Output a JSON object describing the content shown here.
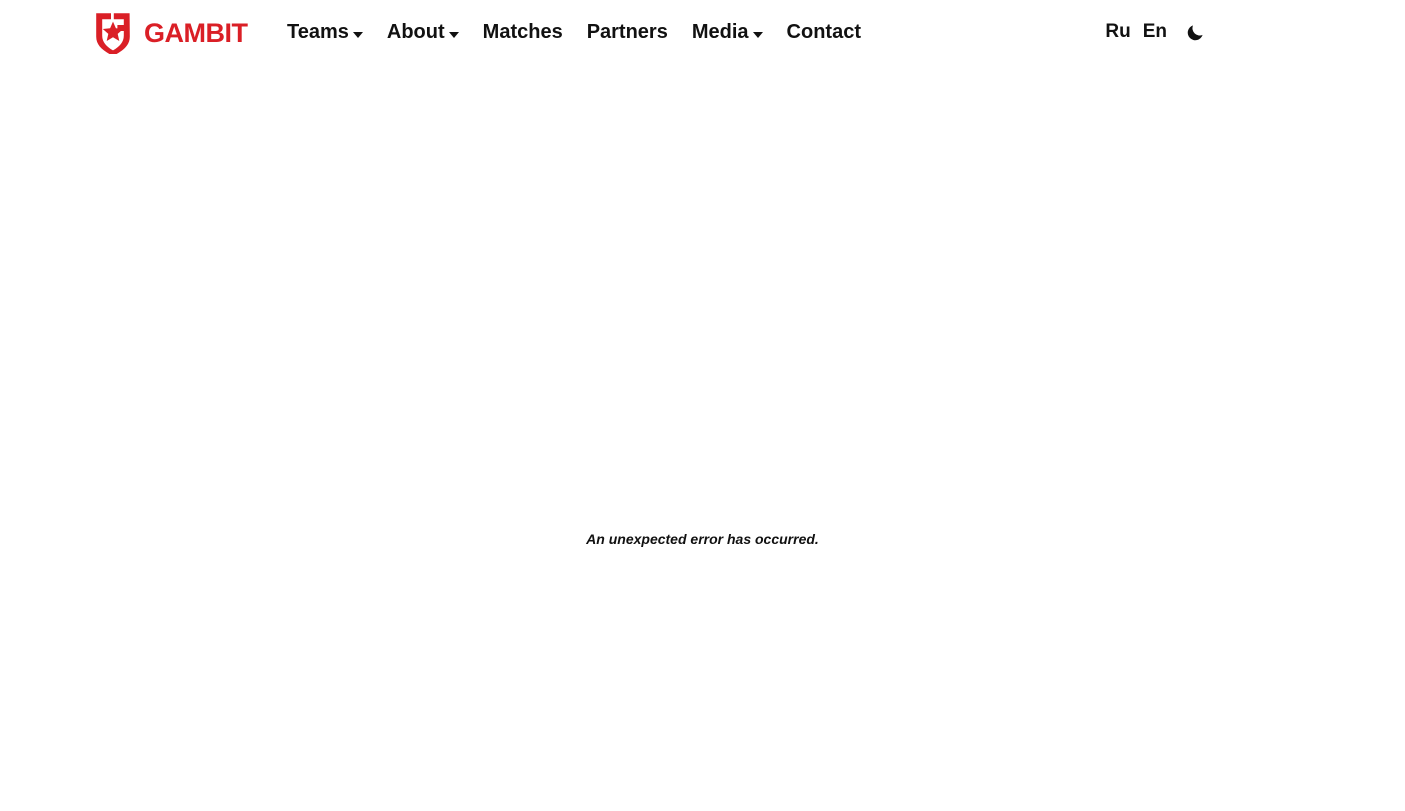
{
  "site": {
    "brand_name": "GAMBIT",
    "brand_icon": "gambit-shield-star-logo",
    "accent_color": "#da1f26",
    "text_color": "#111111",
    "background_color": "#ffffff"
  },
  "header": {
    "nav": [
      {
        "label": "Teams",
        "has_dropdown": true,
        "caret_icon": "chevron-down-icon"
      },
      {
        "label": "About",
        "has_dropdown": true,
        "caret_icon": "chevron-down-icon"
      },
      {
        "label": "Matches",
        "has_dropdown": false,
        "caret_icon": ""
      },
      {
        "label": "Partners",
        "has_dropdown": false,
        "caret_icon": ""
      },
      {
        "label": "Media",
        "has_dropdown": true,
        "caret_icon": "chevron-down-icon"
      },
      {
        "label": "Contact",
        "has_dropdown": false,
        "caret_icon": ""
      }
    ],
    "languages": [
      {
        "label": "Ru",
        "code": "ru"
      },
      {
        "label": "En",
        "code": "en"
      }
    ],
    "theme_toggle": {
      "icon": "moon-icon",
      "title": "Dark mode"
    }
  },
  "main": {
    "error_message": "An unexpected error has occurred."
  }
}
